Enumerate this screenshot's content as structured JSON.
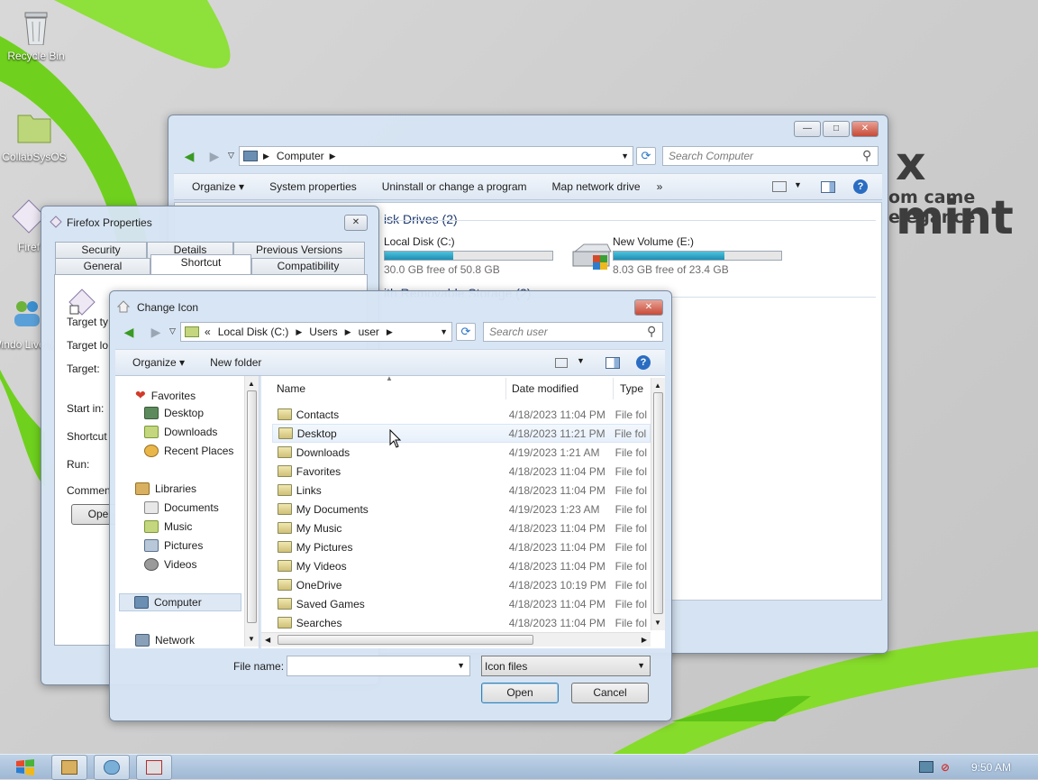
{
  "desktop": {
    "icons": [
      {
        "label": "Recycle Bin"
      },
      {
        "label": "CollabSysOS"
      },
      {
        "label": "Firef"
      },
      {
        "label": "Windo Live Me"
      }
    ],
    "wallpaper_text": "x mint",
    "wallpaper_subtext": "om came elegance"
  },
  "explorer": {
    "address": {
      "crumbs": [
        "Computer"
      ]
    },
    "search_placeholder": "Search Computer",
    "toolbar": {
      "organize": "Organize",
      "system_properties": "System properties",
      "uninstall": "Uninstall or change a program",
      "map_drive": "Map network drive",
      "more": "»"
    },
    "section_title": "isk Drives (2)",
    "section2_title": "ith Removable Storage (2)",
    "drives": [
      {
        "name": "Local Disk (C:)",
        "free": "30.0 GB free of 50.8 GB",
        "used_fraction": 0.41
      },
      {
        "name": "New Volume (E:)",
        "free": "8.03 GB free of 23.4 GB",
        "used_fraction": 0.66
      }
    ]
  },
  "properties": {
    "title": "Firefox Properties",
    "tabs_top": [
      "Security",
      "Details",
      "Previous Versions"
    ],
    "tabs_bottom": [
      "General",
      "Shortcut",
      "Compatibility"
    ],
    "fields": [
      "Target ty",
      "Target lo",
      "Target:",
      "Start in:",
      "Shortcut",
      "Run:",
      "Commen"
    ],
    "open_button": "Ope"
  },
  "dialog": {
    "title": "Change Icon",
    "address": {
      "prefix": "«",
      "crumbs": [
        "Local Disk (C:)",
        "Users",
        "user"
      ]
    },
    "search_placeholder": "Search user",
    "toolbar": {
      "organize": "Organize",
      "new_folder": "New folder"
    },
    "nav": {
      "favorites": "Favorites",
      "favorites_items": [
        "Desktop",
        "Downloads",
        "Recent Places"
      ],
      "libraries": "Libraries",
      "libraries_items": [
        "Documents",
        "Music",
        "Pictures",
        "Videos"
      ],
      "computer": "Computer",
      "network": "Network"
    },
    "columns": {
      "name": "Name",
      "date": "Date modified",
      "type": "Type"
    },
    "files": [
      {
        "name": "Contacts",
        "date": "4/18/2023 11:04 PM",
        "type": "File fol"
      },
      {
        "name": "Desktop",
        "date": "4/18/2023 11:21 PM",
        "type": "File fol"
      },
      {
        "name": "Downloads",
        "date": "4/19/2023 1:21 AM",
        "type": "File fol"
      },
      {
        "name": "Favorites",
        "date": "4/18/2023 11:04 PM",
        "type": "File fol"
      },
      {
        "name": "Links",
        "date": "4/18/2023 11:04 PM",
        "type": "File fol"
      },
      {
        "name": "My Documents",
        "date": "4/19/2023 1:23 AM",
        "type": "File fol"
      },
      {
        "name": "My Music",
        "date": "4/18/2023 11:04 PM",
        "type": "File fol"
      },
      {
        "name": "My Pictures",
        "date": "4/18/2023 11:04 PM",
        "type": "File fol"
      },
      {
        "name": "My Videos",
        "date": "4/18/2023 11:04 PM",
        "type": "File fol"
      },
      {
        "name": "OneDrive",
        "date": "4/18/2023 10:19 PM",
        "type": "File fol"
      },
      {
        "name": "Saved Games",
        "date": "4/18/2023 11:04 PM",
        "type": "File fol"
      },
      {
        "name": "Searches",
        "date": "4/18/2023 11:04 PM",
        "type": "File fol"
      }
    ],
    "filename_label": "File name:",
    "filename_value": "",
    "filetype": "Icon files",
    "open_button": "Open",
    "cancel_button": "Cancel"
  },
  "taskbar": {
    "clock": "9:50 AM"
  }
}
